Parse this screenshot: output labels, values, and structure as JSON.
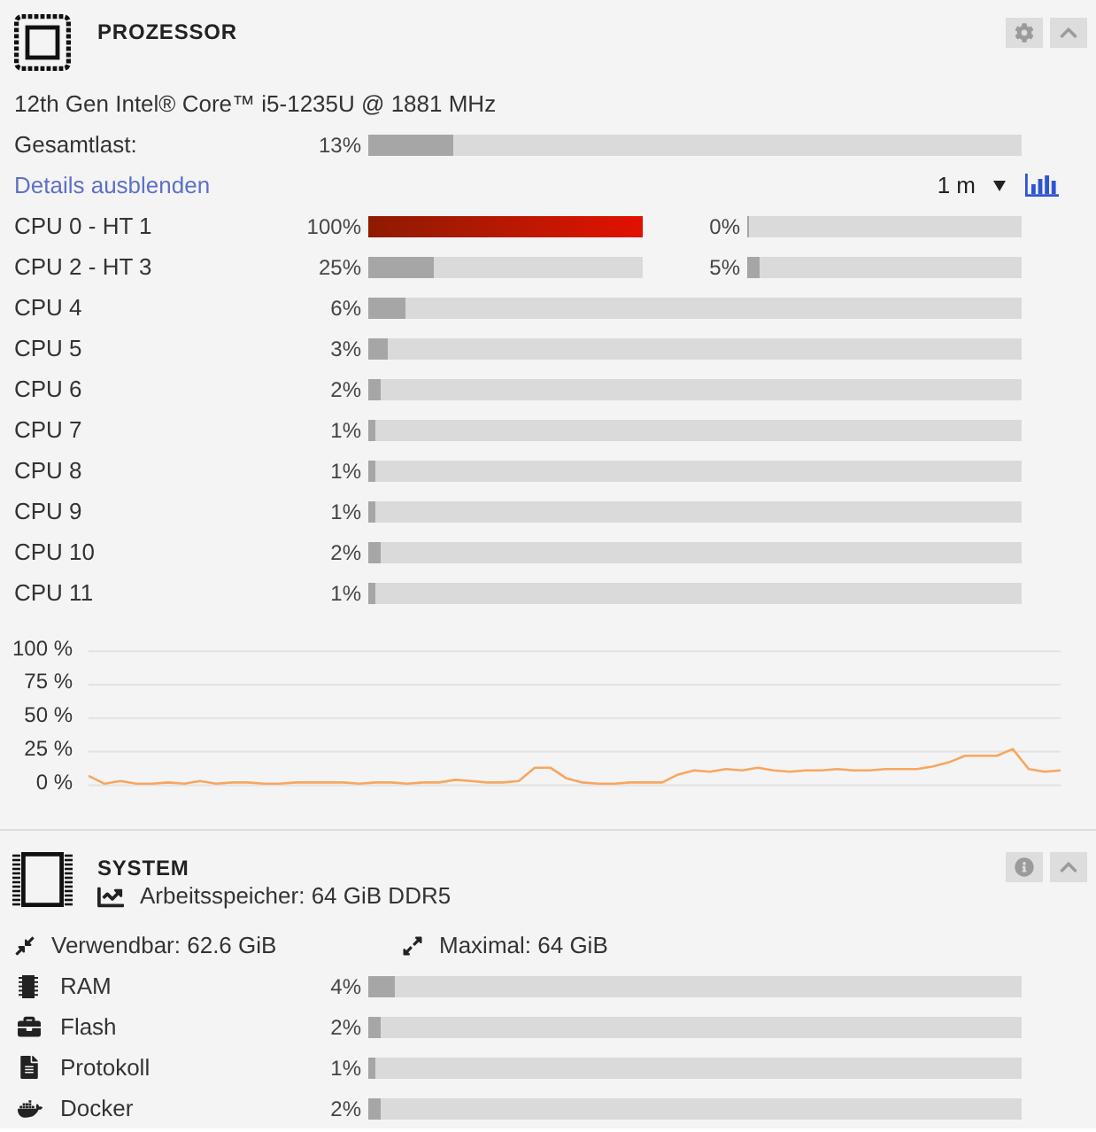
{
  "processor": {
    "title": "PROZESSOR",
    "model": "12th Gen Intel® Core™ i5-1235U @ 1881 MHz",
    "total_load": {
      "label": "Gesamtlast:",
      "reading": "13%",
      "level": 0.13
    },
    "details_link": "Details ausblenden",
    "range_select": {
      "value": "1 m"
    },
    "cores": [
      {
        "label": "CPU 0 - HT 1",
        "threads": [
          {
            "reading": "100%",
            "level": 1
          },
          {
            "reading": "0%",
            "level": 0
          }
        ]
      },
      {
        "label": "CPU 2 - HT 3",
        "threads": [
          {
            "reading": "25%",
            "level": 0.24
          },
          {
            "reading": "5%",
            "level": 0.045
          }
        ]
      },
      {
        "label": "CPU 4",
        "threads": [
          {
            "reading": "6%",
            "level": 0.057
          }
        ]
      },
      {
        "label": "CPU 5",
        "threads": [
          {
            "reading": "3%",
            "level": 0.03
          }
        ]
      },
      {
        "label": "CPU 6",
        "threads": [
          {
            "reading": "2%",
            "level": 0.02
          }
        ]
      },
      {
        "label": "CPU 7",
        "threads": [
          {
            "reading": "1%",
            "level": 0.01
          }
        ]
      },
      {
        "label": "CPU 8",
        "threads": [
          {
            "reading": "1%",
            "level": 0.01
          }
        ]
      },
      {
        "label": "CPU 9",
        "threads": [
          {
            "reading": "1%",
            "level": 0.01
          }
        ]
      },
      {
        "label": "CPU 10",
        "threads": [
          {
            "reading": "2%",
            "level": 0.02
          }
        ]
      },
      {
        "label": "CPU 11",
        "threads": [
          {
            "reading": "1%",
            "level": 0.01
          }
        ]
      }
    ],
    "chart_data": {
      "type": "line",
      "grid": true,
      "ylim": [
        0,
        100
      ],
      "yticks": [
        {
          "value": 0,
          "label": "0 %"
        },
        {
          "value": 25,
          "label": "25 %"
        },
        {
          "value": 50,
          "label": "50 %"
        },
        {
          "value": 75,
          "label": "75 %"
        },
        {
          "value": 100,
          "label": "100 %"
        }
      ],
      "series": [
        {
          "color": "#f8a65f",
          "values": [
            7,
            1,
            3,
            1,
            1,
            2,
            1,
            3,
            1,
            2,
            2,
            1,
            1,
            2,
            2,
            2,
            2,
            1,
            2,
            2,
            1,
            2,
            2,
            4,
            3,
            2,
            2,
            3,
            13,
            13,
            5,
            2,
            1,
            1,
            2,
            2,
            2,
            8,
            11,
            10,
            12,
            11,
            13,
            11,
            10,
            11,
            11,
            12,
            11,
            11,
            12,
            12,
            12,
            14,
            17,
            22,
            22,
            22,
            27,
            12,
            10,
            11
          ]
        }
      ]
    }
  },
  "system": {
    "title": "SYSTEM",
    "memory": "Arbeitsspeicher: 64 GiB DDR5",
    "usable": "Verwendbar: 62.6 GiB",
    "maximum": "Maximal: 64 GiB",
    "resources": [
      {
        "kind": "ram",
        "label": "RAM",
        "reading": "4%",
        "level": 0.04
      },
      {
        "kind": "flash",
        "label": "Flash",
        "reading": "2%",
        "level": 0.02
      },
      {
        "kind": "log",
        "label": "Protokoll",
        "reading": "1%",
        "level": 0.01
      },
      {
        "kind": "docker",
        "label": "Docker",
        "reading": "2%",
        "level": 0.02
      }
    ]
  }
}
